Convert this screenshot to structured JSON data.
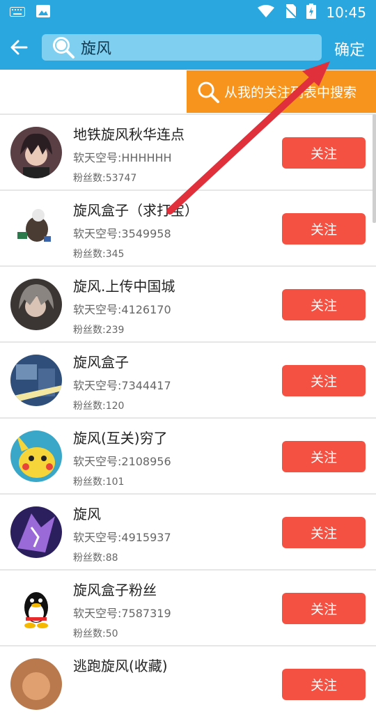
{
  "status": {
    "time": "10:45"
  },
  "header": {
    "query": "旋风",
    "confirm_label": "确定"
  },
  "follow_search_label": "从我的关注列表中搜索",
  "items": [
    {
      "name": "地铁旋风秋华连点",
      "uid": "软天空号:HHHHHH",
      "fans": "粉丝数:53747",
      "button": "关注"
    },
    {
      "name": "旋风盒子（求打宝）",
      "uid": "软天空号:3549958",
      "fans": "粉丝数:345",
      "button": "关注"
    },
    {
      "name": "旋风.上传中国城",
      "uid": "软天空号:4126170",
      "fans": "粉丝数:239",
      "button": "关注"
    },
    {
      "name": "旋风盒子",
      "uid": "软天空号:7344417",
      "fans": "粉丝数:120",
      "button": "关注"
    },
    {
      "name": "旋风(互关)穷了",
      "uid": "软天空号:2108956",
      "fans": "粉丝数:101",
      "button": "关注"
    },
    {
      "name": "旋风",
      "uid": "软天空号:4915937",
      "fans": "粉丝数:88",
      "button": "关注"
    },
    {
      "name": "旋风盒子粉丝",
      "uid": "软天空号:7587319",
      "fans": "粉丝数:50",
      "button": "关注"
    },
    {
      "name": "逃跑旋风(收藏)",
      "uid": "",
      "fans": "",
      "button": "关注"
    }
  ],
  "colors": {
    "primary": "#2aa7df",
    "accent": "#f7941d",
    "follow": "#f55143"
  }
}
